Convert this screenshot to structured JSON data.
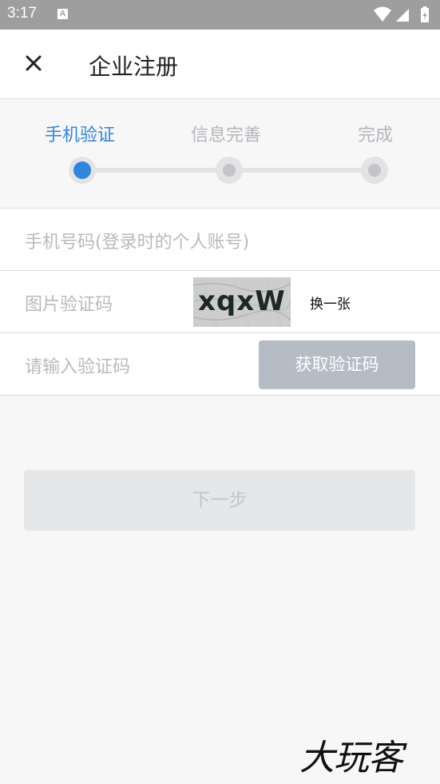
{
  "status_bar": {
    "time": "3:17",
    "notification_badge": "A",
    "icons": [
      "wifi-icon",
      "signal-icon",
      "battery-icon"
    ]
  },
  "header": {
    "close_icon": "close-icon",
    "title": "企业注册"
  },
  "steps": {
    "items": [
      {
        "label": "手机验证",
        "active": true
      },
      {
        "label": "信息完善",
        "active": false
      },
      {
        "label": "完成",
        "active": false
      }
    ],
    "active_color": "#2f86df"
  },
  "form": {
    "phone_placeholder": "手机号码(登录时的个人账号)",
    "captcha_placeholder": "图片验证码",
    "captcha_text": "xqxW",
    "refresh_label": "换一张",
    "code_placeholder": "请输入验证码",
    "get_code_label": "获取验证码"
  },
  "next_button_label": "下一步",
  "watermark": "大玩客"
}
